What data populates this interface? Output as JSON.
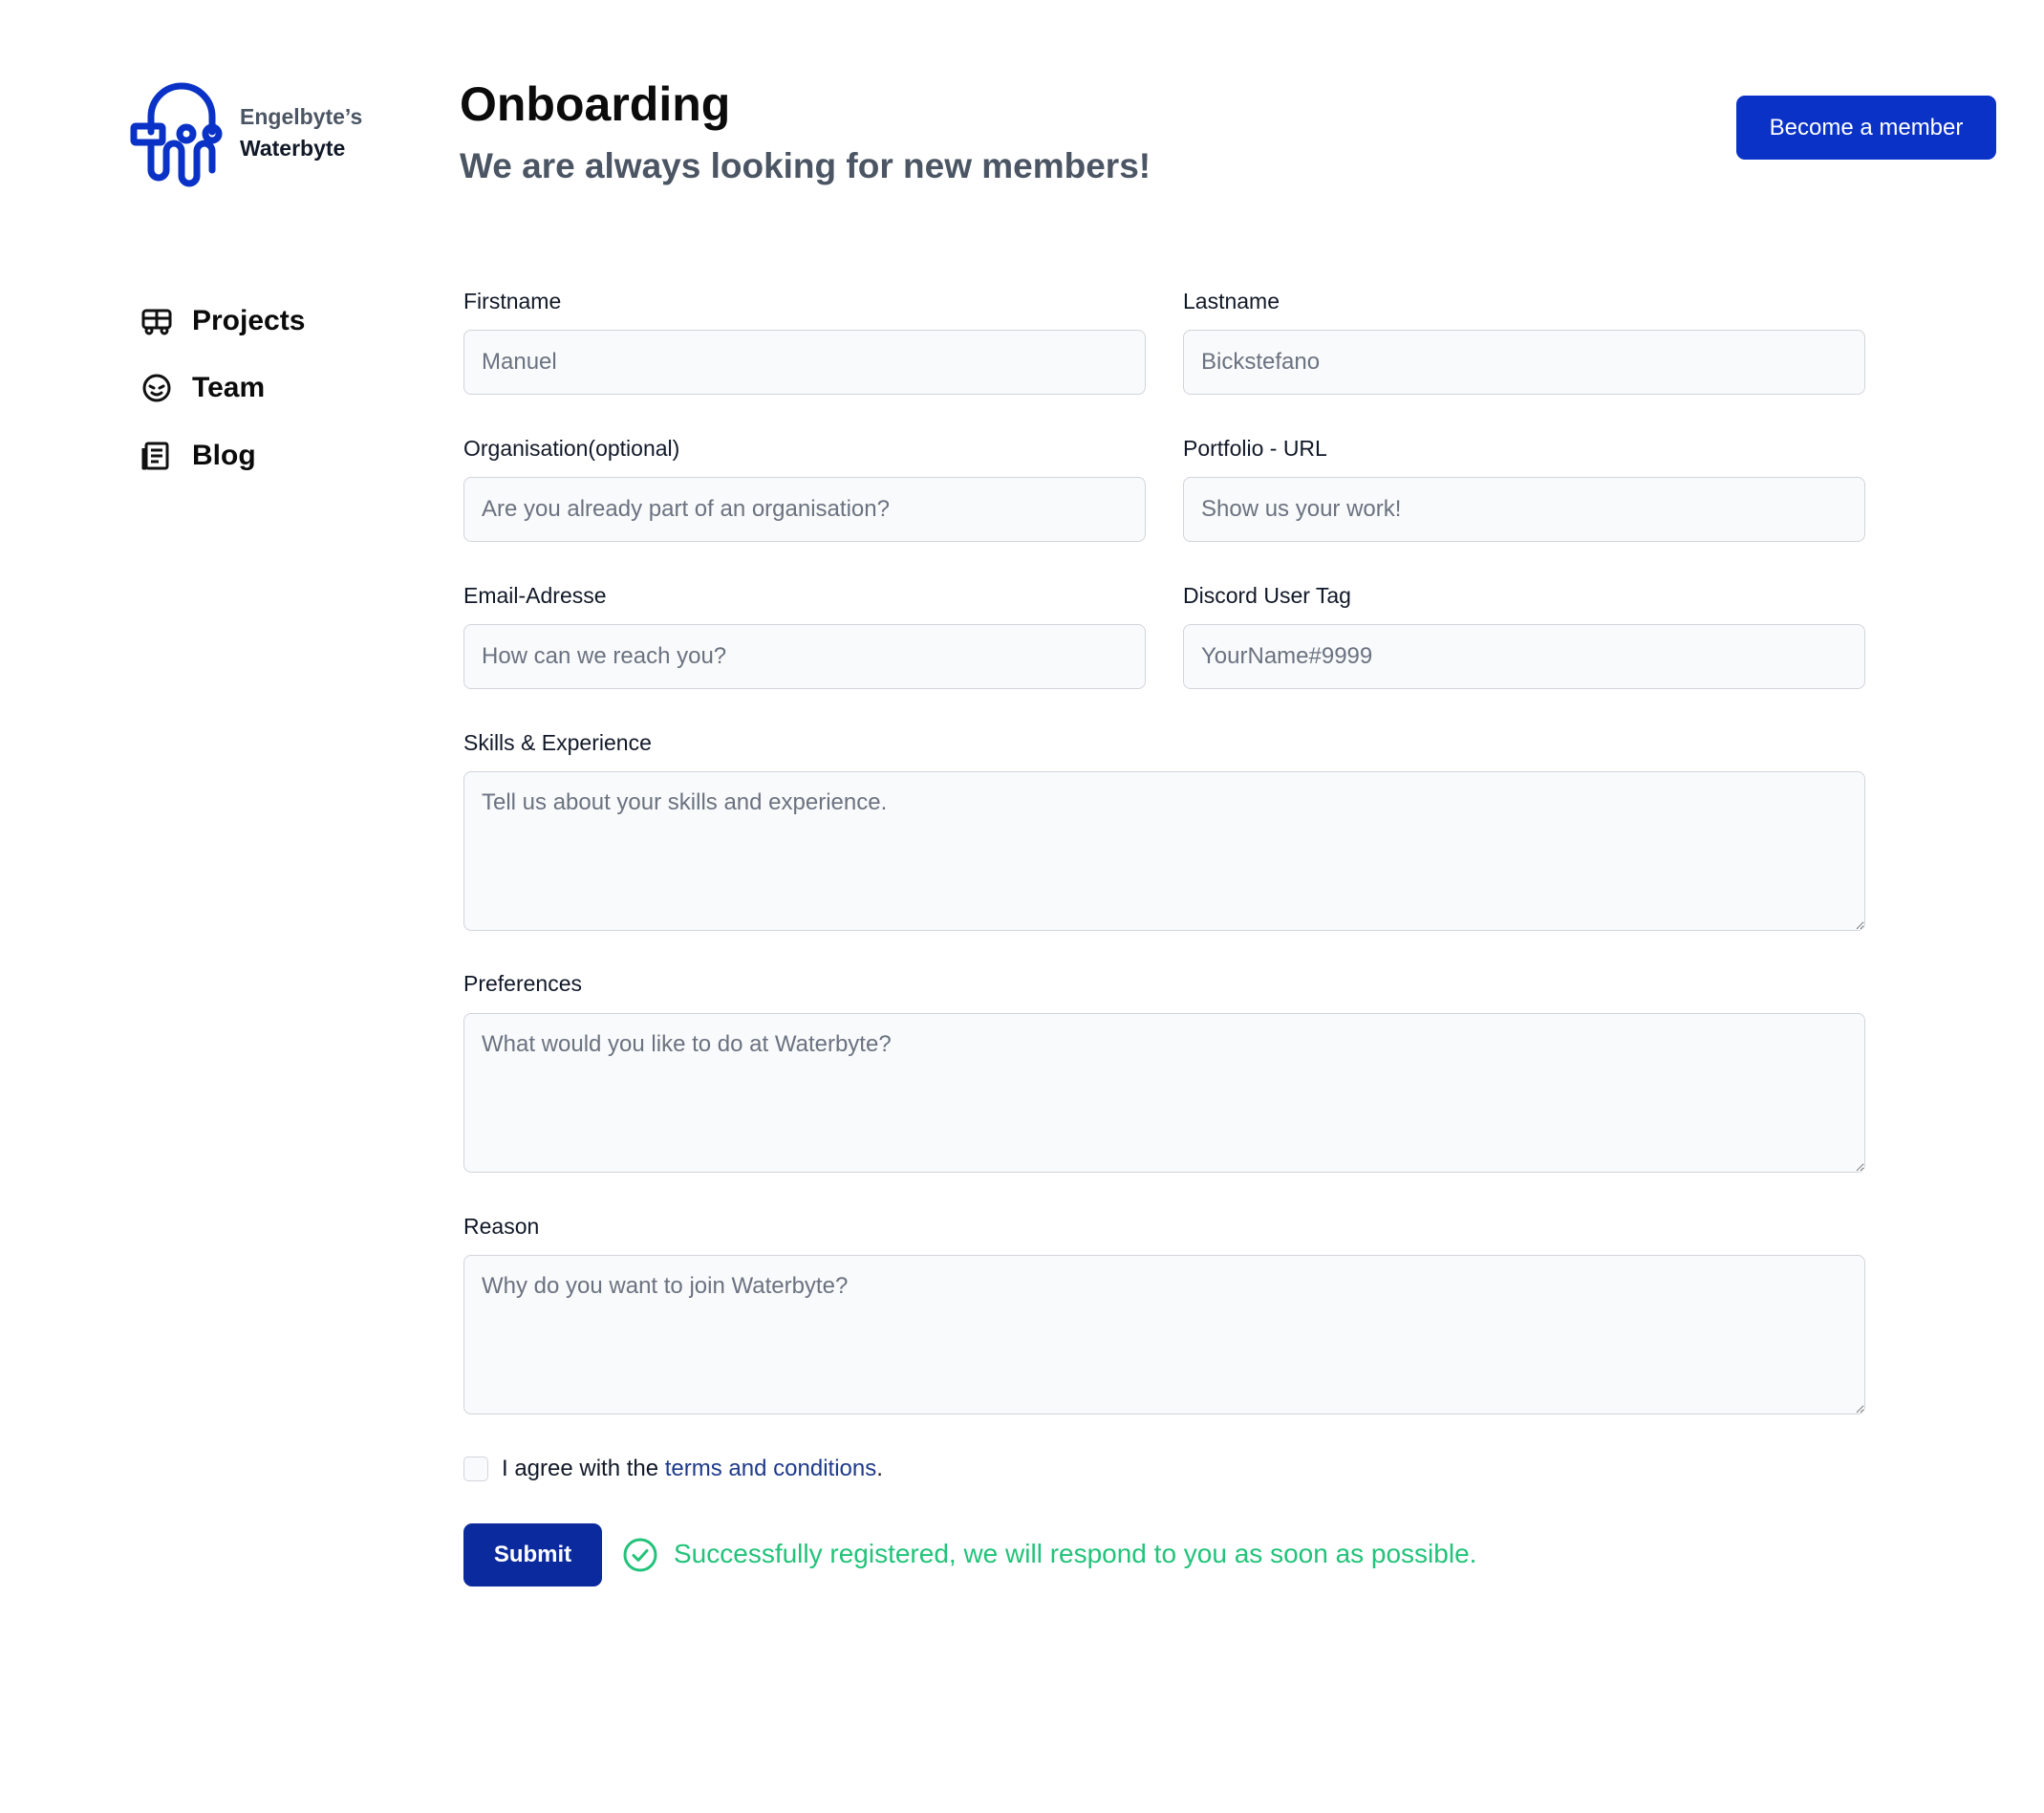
{
  "brand": {
    "line1": "Engelbyte’s",
    "line2": "Waterbyte"
  },
  "header": {
    "title": "Onboarding",
    "subtitle": "We are always looking for new members!",
    "cta_label": "Become a member"
  },
  "sidebar": {
    "items": [
      {
        "label": "Projects",
        "icon": "projects-icon"
      },
      {
        "label": "Team",
        "icon": "team-icon"
      },
      {
        "label": "Blog",
        "icon": "blog-icon"
      }
    ]
  },
  "form": {
    "firstname": {
      "label": "Firstname",
      "placeholder": "Manuel",
      "value": ""
    },
    "lastname": {
      "label": "Lastname",
      "placeholder": "Bickstefano",
      "value": ""
    },
    "organisation": {
      "label": "Organisation(optional)",
      "placeholder": "Are you already part of an organisation?",
      "value": ""
    },
    "portfolio": {
      "label": "Portfolio - URL",
      "placeholder": "Show us your work!",
      "value": ""
    },
    "email": {
      "label": "Email-Adresse",
      "placeholder": "How can we reach you?",
      "value": ""
    },
    "discord": {
      "label": "Discord User Tag",
      "placeholder": "YourName#9999",
      "value": ""
    },
    "skills": {
      "label": "Skills & Experience",
      "placeholder": "Tell us about your skills and experience.",
      "value": ""
    },
    "preferences": {
      "label": "Preferences",
      "placeholder": "What would you like to do at Waterbyte?",
      "value": ""
    },
    "reason": {
      "label": "Reason",
      "placeholder": "Why do you want to join Waterbyte?",
      "value": ""
    },
    "agree": {
      "prefix": "I agree with the ",
      "link": "terms and conditions",
      "suffix": ".",
      "checked": false
    },
    "submit_label": "Submit",
    "success_message": "Successfully registered, we will respond to you as soon as possible."
  },
  "colors": {
    "primary": "#0a32c7",
    "submit": "#0b2a9e",
    "success": "#22c37a",
    "link": "#1e3a8a"
  }
}
